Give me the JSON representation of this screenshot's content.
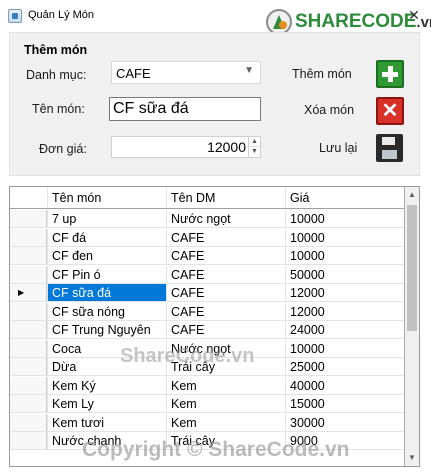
{
  "window": {
    "title": "Quản Lý Món",
    "close_glyph": "✕"
  },
  "logo": {
    "brand": "SHARECODE",
    "suffix": ".vn"
  },
  "form": {
    "group_title": "Thêm món",
    "category_label": "Danh mục:",
    "category_value": "CAFE",
    "name_label": "Tên món:",
    "name_value": "CF sữa đá",
    "price_label": "Đơn giá:",
    "price_value": "12000"
  },
  "actions": {
    "add_label": "Thêm món",
    "delete_label": "Xóa món",
    "save_label": "Lưu lại"
  },
  "grid": {
    "headers": [
      "Tên món",
      "Tên DM",
      "Giá"
    ],
    "selected_marker": "▶",
    "rows": [
      {
        "name": "7 up",
        "category": "Nước ngọt",
        "price": "10000"
      },
      {
        "name": "CF đá",
        "category": "CAFE",
        "price": "10000"
      },
      {
        "name": "CF đen",
        "category": "CAFE",
        "price": "10000"
      },
      {
        "name": "CF Pin ó",
        "category": "CAFE",
        "price": "50000"
      },
      {
        "name": "CF sữa đá",
        "category": "CAFE",
        "price": "12000",
        "selected": true
      },
      {
        "name": "CF sữa nóng",
        "category": "CAFE",
        "price": "12000"
      },
      {
        "name": "CF Trung Nguyên",
        "category": "CAFE",
        "price": "24000"
      },
      {
        "name": "Coca",
        "category": "Nước ngọt",
        "price": "10000"
      },
      {
        "name": "Dừa",
        "category": "Trái cây",
        "price": "25000"
      },
      {
        "name": "Kem Ký",
        "category": "Kem",
        "price": "40000"
      },
      {
        "name": "Kem Ly",
        "category": "Kem",
        "price": "15000"
      },
      {
        "name": "Kem tươi",
        "category": "Kem",
        "price": "30000"
      },
      {
        "name": "Nước chanh",
        "category": "Trái cây",
        "price": "9000"
      }
    ]
  },
  "watermarks": {
    "center": "ShareCode.vn",
    "bottom": "Copyright © ShareCode.vn"
  },
  "colors": {
    "selection": "#0078d7",
    "add": "#2f9a34",
    "delete": "#d9302a",
    "brand": "#2e8b3a"
  }
}
